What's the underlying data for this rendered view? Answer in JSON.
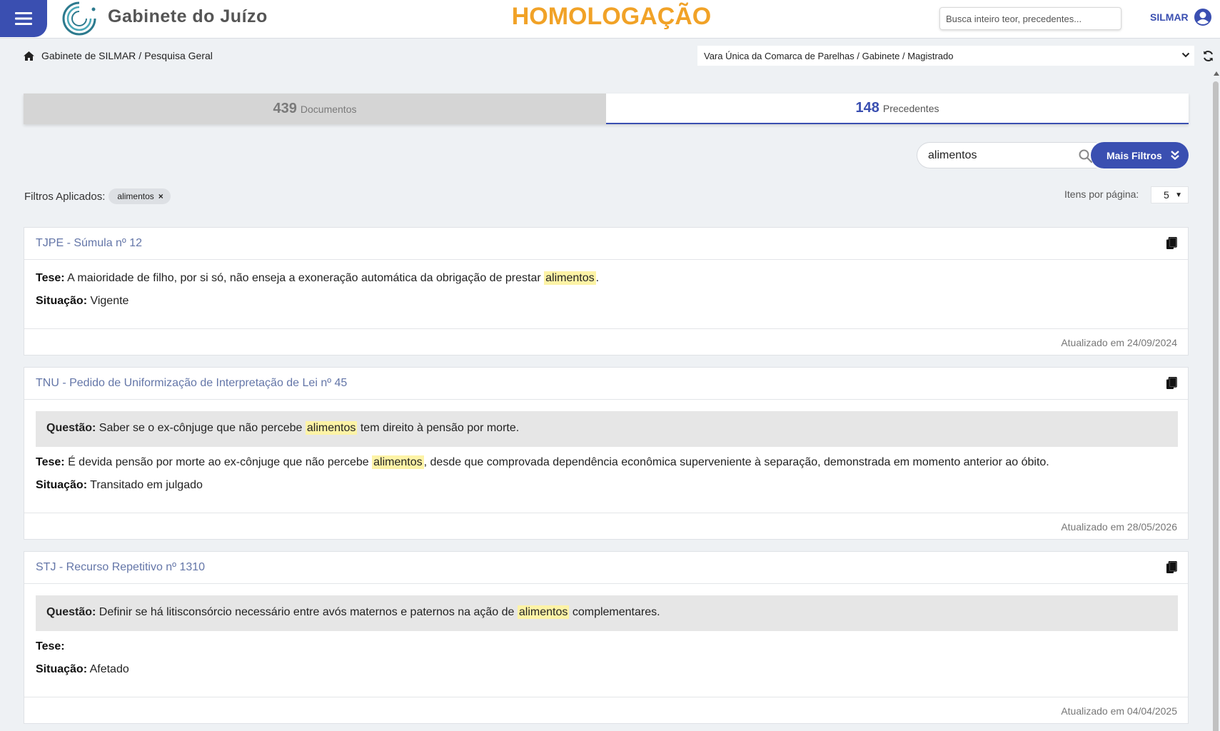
{
  "header": {
    "app_title": "Gabinete do Juízo",
    "environment": "HOMOLOGAÇÃO",
    "search_placeholder": "Busca inteiro teor, precedentes...",
    "user": "SILMAR",
    "accent_color": "#3a4fb1",
    "env_color": "#f1a227"
  },
  "breadcrumb": {
    "home": "Gabinete de SILMAR",
    "current": "Pesquisa Geral",
    "separator": "/"
  },
  "unit_select": {
    "selected": "Vara Única da Comarca de Parelhas / Gabinete / Magistrado"
  },
  "tabs": [
    {
      "count": "439",
      "label": "Documentos",
      "active": false
    },
    {
      "count": "148",
      "label": "Precedentes",
      "active": true
    }
  ],
  "search": {
    "value": "alimentos",
    "more_filters_label": "Mais Filtros"
  },
  "filters": {
    "label": "Filtros Aplicados:",
    "chips": [
      {
        "label": "alimentos",
        "close": "×"
      }
    ]
  },
  "pagination": {
    "label": "Itens por página:",
    "value": "5"
  },
  "labels": {
    "tese": "Tese:",
    "situacao": "Situação:",
    "questao": "Questão:"
  },
  "cards": [
    {
      "title": "TJPE - Súmula nº 12",
      "tese_before": "A maioridade de filho, por si só, não enseja a exoneração automática da obrigação de prestar",
      "tese_highlight": "alimentos",
      "tese_after": ".",
      "situacao": "Vigente",
      "updated": "Atualizado em 24/09/2024"
    },
    {
      "title": "TNU - Pedido de Uniformização de Interpretação de Lei nº 45",
      "questao_before": "Saber se o ex-cônjuge que não percebe",
      "questao_highlight": "alimentos",
      "questao_after": "tem direito à pensão por morte.",
      "tese_before": "É devida pensão por morte ao ex-cônjuge que não percebe",
      "tese_highlight": "alimentos",
      "tese_after": ", desde que comprovada dependência econômica superveniente à separação, demonstrada em momento anterior ao óbito.",
      "situacao": "Transitado em julgado",
      "updated": "Atualizado em 28/05/2026"
    },
    {
      "title": "STJ - Recurso Repetitivo nº 1310",
      "questao_before": "Definir se há litisconsórcio necessário entre avós maternos e paternos na ação de",
      "questao_highlight": "alimentos",
      "questao_after": "complementares.",
      "situacao": "Afetado",
      "updated": "Atualizado em 04/04/2025"
    }
  ]
}
